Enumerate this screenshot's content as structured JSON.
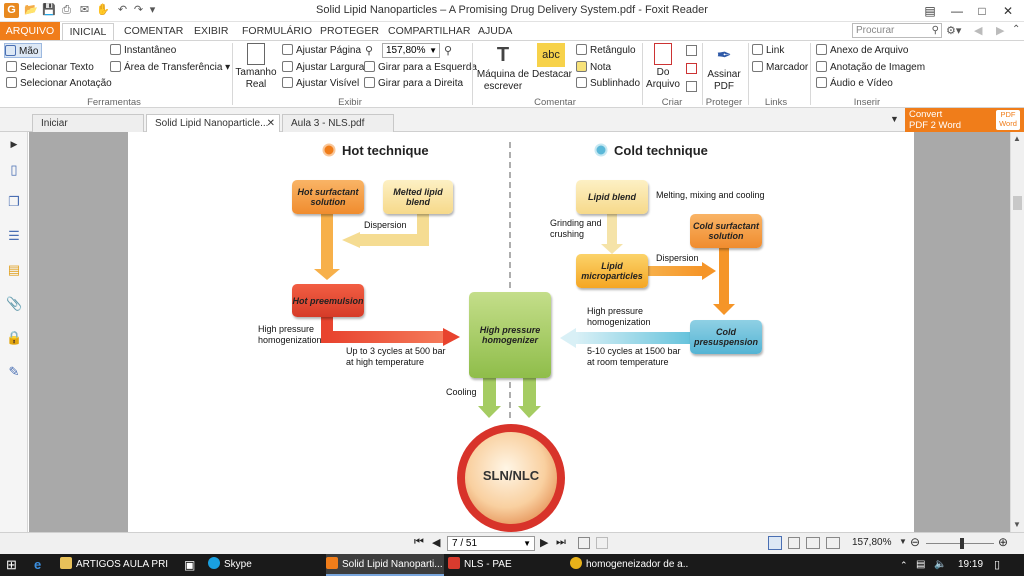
{
  "window": {
    "title": "Solid Lipid Nanoparticles – A Promising Drug Delivery System.pdf - Foxit Reader",
    "app_icon": "G"
  },
  "ribbon_tabs": [
    "ARQUIVO",
    "INICIAL",
    "COMENTAR",
    "EXIBIR",
    "FORMULÁRIO",
    "PROTEGER",
    "COMPARTILHAR",
    "AJUDA"
  ],
  "search": {
    "placeholder": "Procurar"
  },
  "ribbon": {
    "ferramentas": {
      "mao": "Mão",
      "selecionar_texto": "Selecionar Texto",
      "selecionar_anotacao": "Selecionar Anotação",
      "instantaneo": "Instantâneo",
      "area_transferencia": "Área de Transferência",
      "group": "Ferramentas"
    },
    "exibir": {
      "tamanho_real_1": "Tamanho",
      "tamanho_real_2": "Real",
      "ajustar_pagina": "Ajustar Página",
      "ajustar_largura": "Ajustar Largura",
      "ajustar_visivel": "Ajustar Visível",
      "zoom": "157,80%",
      "girar_esquerda": "Girar para a Esquerda",
      "girar_direita": "Girar para a Direita",
      "group": "Exibir"
    },
    "comentar": {
      "maquina_1": "Máquina de",
      "maquina_2": "escrever",
      "destacar": "Destacar",
      "retangulo": "Retângulo",
      "nota": "Nota",
      "sublinhado": "Sublinhado",
      "group": "Comentar",
      "abc": "abc"
    },
    "criar": {
      "do_arquivo_1": "Do",
      "do_arquivo_2": "Arquivo",
      "group": "Criar"
    },
    "proteger": {
      "assinar_1": "Assinar",
      "assinar_2": "PDF",
      "group": "Proteger"
    },
    "links": {
      "link": "Link",
      "marcador": "Marcador",
      "group": "Links"
    },
    "inserir": {
      "anexo": "Anexo de Arquivo",
      "anotacao_imagem": "Anotação de Imagem",
      "audio_video": "Áudio e Vídeo",
      "group": "Inserir"
    }
  },
  "doc_tabs": [
    "Iniciar",
    "Solid Lipid Nanoparticle...",
    "Aula 3 - NLS.pdf"
  ],
  "convert": {
    "line1": "Convert",
    "line2": "PDF 2 Word",
    "badge1": "PDF",
    "badge2": "Word"
  },
  "diagram": {
    "hot_title": "Hot technique",
    "cold_title": "Cold technique",
    "hot_surfactant": "Hot surfactant solution",
    "melted_lipid": "Melted lipid blend",
    "dispersion_hot": "Dispersion",
    "hot_premulsion": "Hot preemulsion",
    "hp_homog_left": "High pressure\nhomogenization",
    "cycles_hot": "Up to 3 cycles at 500 bar\nat high temperature",
    "homogenizer": "High pressure homogenizer",
    "cooling": "Cooling",
    "sln": "SLN/NLC",
    "lipid_blend": "Lipid blend",
    "melting": "Melting, mixing and cooling",
    "grinding": "Grinding and\ncrushing",
    "cold_surfactant": "Cold surfactant solution",
    "lipid_micro": "Lipid microparticles",
    "dispersion_cold": "Dispersion",
    "hp_homog_right": "High pressure\nhomogenization",
    "cold_presusp": "Cold presuspension",
    "cycles_cold": "5-10 cycles at 1500 bar\nat room temperature"
  },
  "status": {
    "page": "7 / 51",
    "zoom": "157,80%"
  },
  "taskbar": {
    "items": [
      "ARTIGOS AULA PRI",
      "Skype",
      "Solid Lipid Nanoparti...",
      "NLS - PAE",
      "homogeneizador de a..."
    ],
    "time": "19:19"
  },
  "colors": {
    "accent": "#f07d1a",
    "hot_dot": "#f07d1a",
    "cold_dot": "#5bb8d8"
  }
}
